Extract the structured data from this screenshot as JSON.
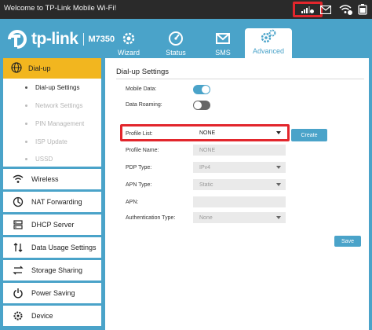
{
  "topbar": {
    "welcome": "Welcome to TP-Link Mobile Wi-Fi!"
  },
  "logo": {
    "brand": "tp-link",
    "model": "M7350"
  },
  "tabs": [
    {
      "label": "Wizard",
      "icon": "gear-wand-icon"
    },
    {
      "label": "Status",
      "icon": "status-gauge-icon"
    },
    {
      "label": "SMS",
      "icon": "envelope-icon"
    },
    {
      "label": "Advanced",
      "icon": "gears-icon"
    }
  ],
  "sidebar": {
    "active": {
      "label": "Dial-up",
      "icon": "globe-icon"
    },
    "subitems": [
      {
        "label": "Dial-up Settings",
        "enabled": true
      },
      {
        "label": "Network Settings",
        "enabled": false
      },
      {
        "label": "PIN Management",
        "enabled": false
      },
      {
        "label": "ISP Update",
        "enabled": false
      },
      {
        "label": "USSD",
        "enabled": false
      }
    ],
    "items": [
      {
        "label": "Wireless",
        "icon": "wifi-icon"
      },
      {
        "label": "NAT Forwarding",
        "icon": "nat-icon"
      },
      {
        "label": "DHCP Server",
        "icon": "server-icon"
      },
      {
        "label": "Data Usage Settings",
        "icon": "data-arrows-icon"
      },
      {
        "label": "Storage Sharing",
        "icon": "share-icon"
      },
      {
        "label": "Power Saving",
        "icon": "power-icon"
      },
      {
        "label": "Device",
        "icon": "device-gear-icon"
      }
    ]
  },
  "content": {
    "title": "Dial-up Settings",
    "mobile_data": {
      "label": "Mobile Data:",
      "on": true
    },
    "data_roaming": {
      "label": "Data Roaming:",
      "on": false
    },
    "profile_list": {
      "label": "Profile List:",
      "value": "NONE"
    },
    "create_label": "Create",
    "profile_name": {
      "label": "Profile Name:",
      "value": "NONE"
    },
    "pdp_type": {
      "label": "PDP Type:",
      "value": "IPv4"
    },
    "apn_type": {
      "label": "APN Type:",
      "value": "Static"
    },
    "apn": {
      "label": "APN:",
      "value": ""
    },
    "auth_type": {
      "label": "Authentication Type:",
      "value": "None"
    },
    "save_label": "Save"
  },
  "colors": {
    "accent": "#4aa3c9",
    "active_sidebar": "#f2b61f",
    "highlight": "#e2262c"
  }
}
